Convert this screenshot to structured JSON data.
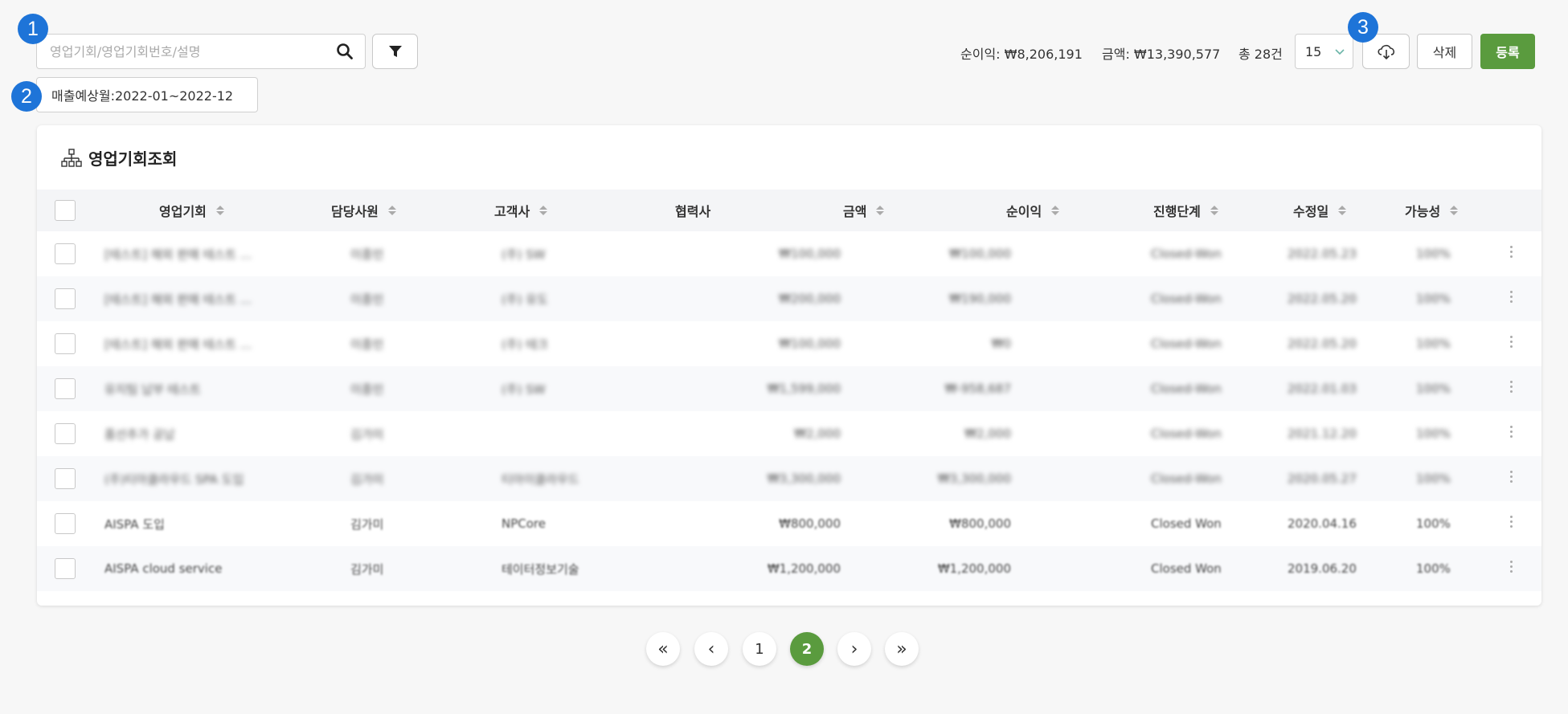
{
  "annotations": [
    "1",
    "2",
    "3"
  ],
  "search": {
    "placeholder": "영업기회/영업기회번호/설명",
    "value": ""
  },
  "filter_chip": "매출예상월:2022-01~2022-12",
  "summary": {
    "profit": "순이익: ₩8,206,191",
    "amount": "금액: ₩13,390,577",
    "total": "총 28건"
  },
  "page_size": "15",
  "buttons": {
    "delete": "삭제",
    "register": "등록"
  },
  "card_title": "영업기회조회",
  "columns": [
    "영업기회",
    "담당사원",
    "고객사",
    "협력사",
    "금액",
    "순이익",
    "진행단계",
    "수정일",
    "가능성"
  ],
  "rows": [
    {
      "opportunity": "[테스트] 해외 판매 테스트 ...",
      "owner": "이종민",
      "customer": "(주) SW",
      "partner": "",
      "amount": "₩100,000",
      "profit": "₩100,000",
      "stage": "Closed-Won",
      "modified": "2022.05.23",
      "probability": "100%"
    },
    {
      "opportunity": "[테스트] 해외 판매 테스트 ...",
      "owner": "이종민",
      "customer": "(주) 유도",
      "partner": "",
      "amount": "₩200,000",
      "profit": "₩190,000",
      "stage": "Closed-Won",
      "modified": "2022.05.20",
      "probability": "100%"
    },
    {
      "opportunity": "[테스트] 해외 판매 테스트 ...",
      "owner": "이종민",
      "customer": "(주) 테크",
      "partner": "",
      "amount": "₩100,000",
      "profit": "₩0",
      "stage": "Closed-Won",
      "modified": "2022.05.20",
      "probability": "100%"
    },
    {
      "opportunity": "유지팀 납부 테스트",
      "owner": "이종민",
      "customer": "(주) SW",
      "partner": "",
      "amount": "₩1,599,000",
      "profit": "₩-958,687",
      "stage": "Closed-Won",
      "modified": "2022.01.03",
      "probability": "100%"
    },
    {
      "opportunity": "품선추가 공납",
      "owner": "김가미",
      "customer": "",
      "partner": "",
      "amount": "₩2,000",
      "profit": "₩2,000",
      "stage": "Closed-Won",
      "modified": "2021.12.20",
      "probability": "100%"
    },
    {
      "opportunity": "(주)티아클라우드 SPA 도입",
      "owner": "김가미",
      "customer": "티아이클라우드",
      "partner": "",
      "amount": "₩3,300,000",
      "profit": "₩3,300,000",
      "stage": "Closed-Won",
      "modified": "2020.05.27",
      "probability": "100%"
    },
    {
      "opportunity": "AISPA 도입",
      "owner": "김가미",
      "customer": "NPCore",
      "partner": "",
      "amount": "₩800,000",
      "profit": "₩800,000",
      "stage": "Closed Won",
      "modified": "2020.04.16",
      "probability": "100%"
    },
    {
      "opportunity": "AISPA cloud service",
      "owner": "김가미",
      "customer": "테이터정보기술",
      "partner": "",
      "amount": "₩1,200,000",
      "profit": "₩1,200,000",
      "stage": "Closed Won",
      "modified": "2019.06.20",
      "probability": "100%"
    }
  ],
  "pagination": {
    "first": "«",
    "prev": "‹",
    "pages": [
      "1",
      "2"
    ],
    "current": "2",
    "next": "›",
    "last": "»"
  },
  "colors": {
    "accent_green": "#5a9b3e",
    "badge_blue": "#1e74d8"
  }
}
